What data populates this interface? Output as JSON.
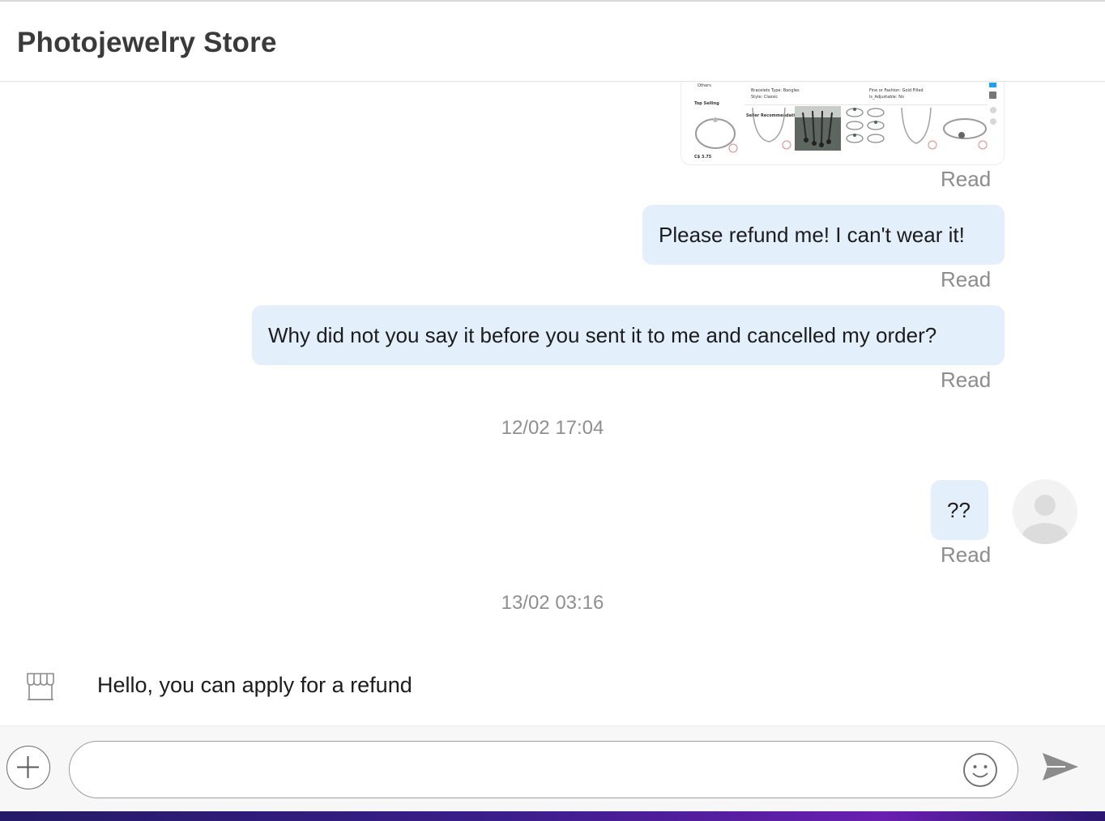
{
  "header": {
    "title": "Photojewelry Store"
  },
  "image_message": {
    "sidebar_label_others": "Others",
    "sidebar_label_top_selling": "Top Selling",
    "price": "C$ 3.75",
    "section_title": "Seller Recommendations",
    "spec_rows": [
      "Bracelets Type: Bangles",
      "Style: Classic",
      "Fine or Fashion: Gold Filled",
      "is_Adjustable: No"
    ],
    "status": "Read"
  },
  "messages": [
    {
      "text": "Please refund me! I can't wear it!",
      "status": "Read"
    },
    {
      "text": "Why did not you say it before you sent it to me and cancelled my order?",
      "status": "Read"
    },
    {
      "text": "??",
      "status": "Read"
    }
  ],
  "timestamps": [
    "12/02 17:04",
    "13/02 03:16"
  ],
  "incoming": {
    "text": "Hello, you can apply for a refund"
  },
  "composer": {
    "placeholder": ""
  },
  "icons": {
    "plus": "plus-icon",
    "emoji": "smiley-icon",
    "send": "send-icon",
    "store": "store-icon",
    "avatar": "user-avatar-icon"
  },
  "colors": {
    "bubble": "#e3f0fc",
    "status_text": "#8c8c8c",
    "accent_bar": "#3a1e8a"
  }
}
